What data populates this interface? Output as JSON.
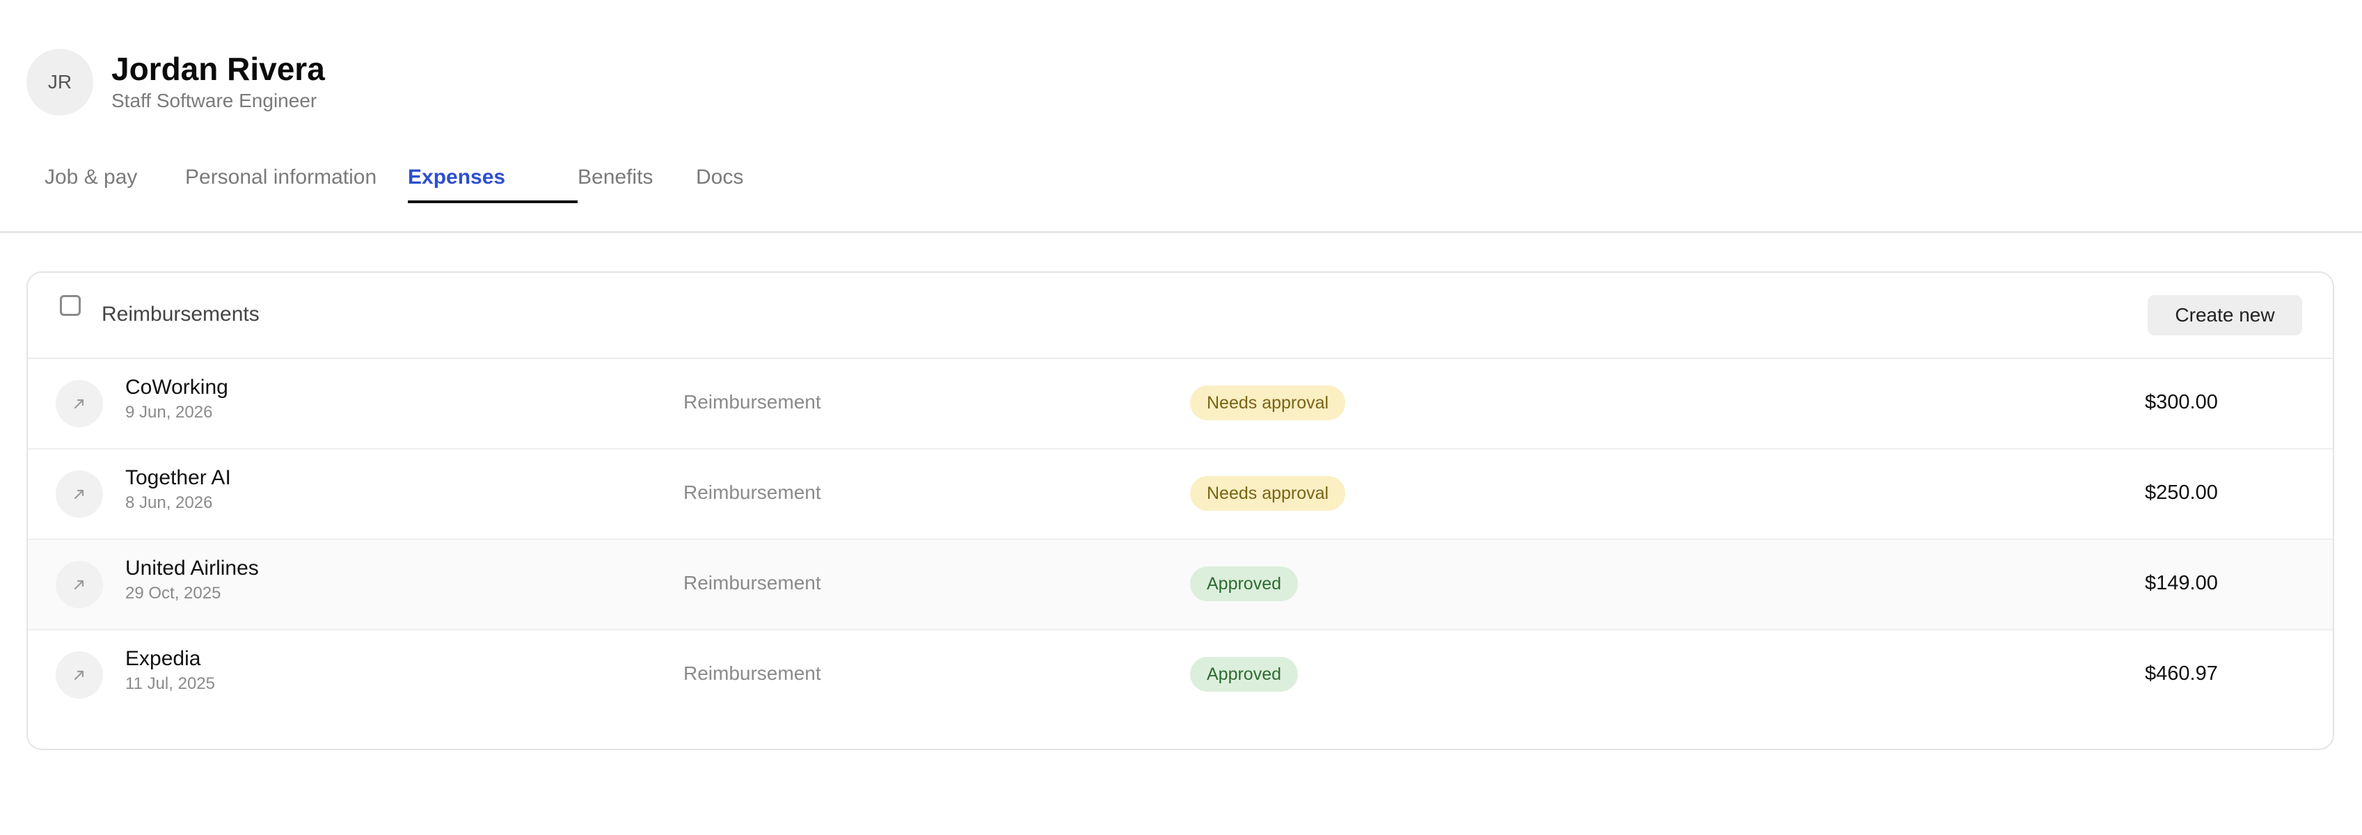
{
  "profile": {
    "initials": "JR",
    "name": "Jordan Rivera",
    "title": "Staff Software Engineer"
  },
  "tabs": [
    {
      "label": "Job & pay",
      "active": false
    },
    {
      "label": "Personal information",
      "active": false
    },
    {
      "label": "Expenses",
      "active": true
    },
    {
      "label": "Benefits",
      "active": false
    },
    {
      "label": "Docs",
      "active": false
    }
  ],
  "reimbursements": {
    "title": "Reimbursements",
    "create_label": "Create new",
    "rows": [
      {
        "icon": "arrow-up-right-icon",
        "name": "CoWorking",
        "date": "9 Jun, 2026",
        "type": "Reimbursement",
        "status": "Needs approval",
        "status_kind": "pending",
        "amount": "$300.00"
      },
      {
        "icon": "arrow-up-right-icon",
        "name": "Together AI",
        "date": "8 Jun, 2026",
        "type": "Reimbursement",
        "status": "Needs approval",
        "status_kind": "pending",
        "amount": "$250.00"
      },
      {
        "icon": "arrow-up-right-icon",
        "name": "United Airlines",
        "date": "29 Oct, 2025",
        "type": "Reimbursement",
        "status": "Approved",
        "status_kind": "approved",
        "amount": "$149.00"
      },
      {
        "icon": "arrow-up-right-icon",
        "name": "Expedia",
        "date": "11 Jul, 2025",
        "type": "Reimbursement",
        "status": "Approved",
        "status_kind": "approved",
        "amount": "$460.97"
      }
    ]
  },
  "colors": {
    "accent": "#2d4fcf",
    "pending_bg": "#fbefc4",
    "pending_text": "#7a6414",
    "approved_bg": "#dcefdc",
    "approved_text": "#2e6b32"
  }
}
